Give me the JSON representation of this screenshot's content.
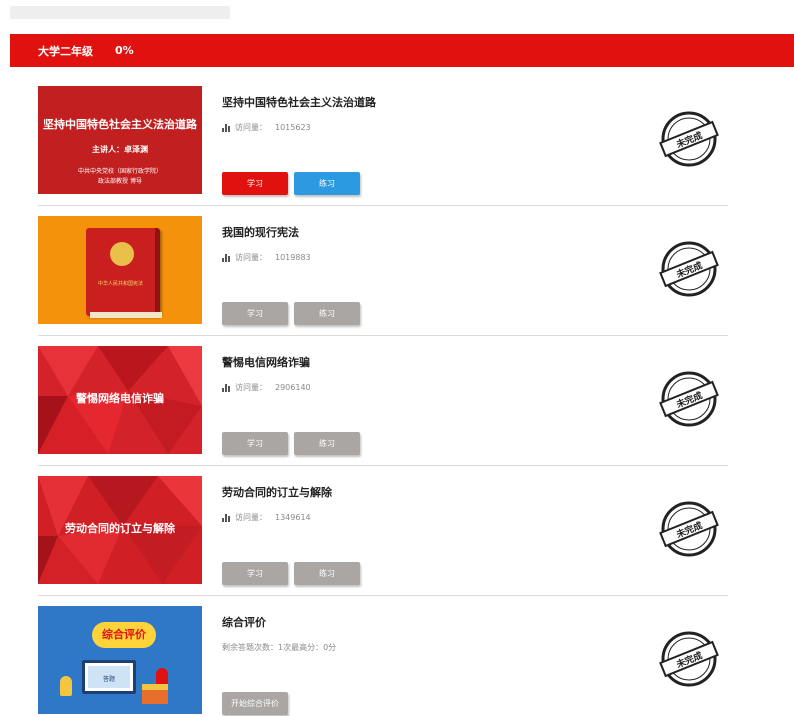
{
  "header": {
    "title": "大学二年级",
    "progress": "0%"
  },
  "icons": {
    "visit": "bar-chart-icon",
    "stamp": "unfinished-stamp-icon"
  },
  "colors": {
    "brand_red": "#e0110f",
    "practice_blue": "#2b9ae0",
    "disabled_gray": "#a9a6a4"
  },
  "courses": [
    {
      "title": "坚持中国特色社会主义法治道路",
      "visit_label": "访问量：",
      "visit_count": "1015623",
      "thumb_main": "坚持中国特色社会主义法治道路",
      "thumb_sub": "主讲人：卓泽渊",
      "thumb_foot1": "中共中央党校（国家行政学院）",
      "thumb_foot2": "政法部教授 博导",
      "btn_study": "学习",
      "btn_practice": "练习",
      "status": "未完成"
    },
    {
      "title": "我国的现行宪法",
      "visit_label": "访问量：",
      "visit_count": "1019883",
      "thumb_book": "中华人民共和国宪法",
      "btn_study": "学习",
      "btn_practice": "练习",
      "status": "未完成"
    },
    {
      "title": "警惕电信网络诈骗",
      "visit_label": "访问量：",
      "visit_count": "2906140",
      "thumb_text": "警惕网络电信诈骗",
      "btn_study": "学习",
      "btn_practice": "练习",
      "status": "未完成"
    },
    {
      "title": "劳动合同的订立与解除",
      "visit_label": "访问量：",
      "visit_count": "1349614",
      "thumb_text": "劳动合同的订立与解除",
      "btn_study": "学习",
      "btn_practice": "练习",
      "status": "未完成"
    },
    {
      "title": "综合评价",
      "info": "剩余答题次数：1次最高分：0分",
      "thumb_bubble": "综合评价",
      "thumb_screen": "答题",
      "btn_start": "开始综合评价",
      "status": "未完成"
    }
  ]
}
